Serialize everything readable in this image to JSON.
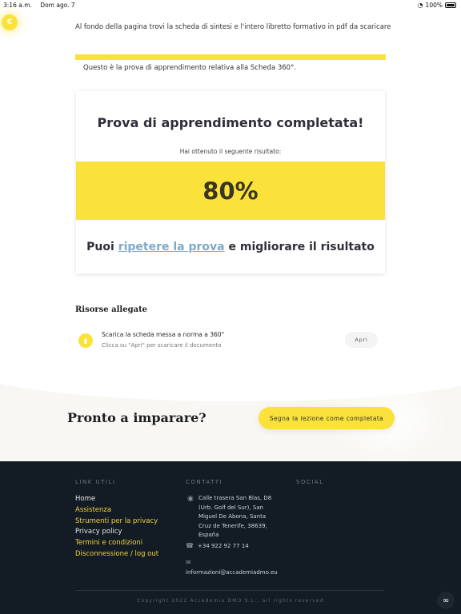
{
  "status_bar": {
    "time": "3:16 a.m.",
    "date": "Dom ago. 7",
    "battery": "100%"
  },
  "coin_symbol": "€",
  "intro_text": "Al fondo della pagina trovi la scheda di sintesi e l'intero libretto formativo in pdf da scaricare",
  "quiz_intro": "Questo è la prova di apprendimento relativa alla Scheda 360°.",
  "result_card": {
    "title": "Prova di apprendimento completata!",
    "subtitle": "Hai ottenuto il seguente risultato:",
    "score": "80%",
    "retry_prefix": "Puoi ",
    "retry_link": "ripetere la prova",
    "retry_suffix": " e migliorare il risultato"
  },
  "resources": {
    "title": "Risorse allegate",
    "items": [
      {
        "name": "Scarica la scheda messa a norma a 360°",
        "hint": "Clicca su \"Apri\" per scaricare il documento",
        "button": "Apri"
      }
    ]
  },
  "cta": {
    "title": "Pronto a imparare?",
    "button": "Segna la lezione come completata"
  },
  "footer": {
    "links_title": "LINK UTILI",
    "links": [
      "Home",
      "Assistenza",
      "Strumenti per la privacy",
      "Privacy policy",
      "Termini e condizioni",
      "Disconnessione / log out"
    ],
    "contacts_title": "CONTATTI",
    "address": "Calle trasera San Blas, D8 (Urb. Golf del Sur), San Miguel De Abona, Santa Cruz de Tenerife, 38639, España",
    "phone": "+34 922 92 77 14",
    "email": "informazioni@accademiadmo.eu",
    "social_title": "SOCIAL",
    "copyright": "Copyright 2022 Accademia DMO S.L., all rights reserved"
  },
  "colors": {
    "accent_yellow": "#fbe23a",
    "footer_bg": "#131b25",
    "link_blue": "#7fa9c9",
    "footer_link_gold": "#f2d33a"
  }
}
